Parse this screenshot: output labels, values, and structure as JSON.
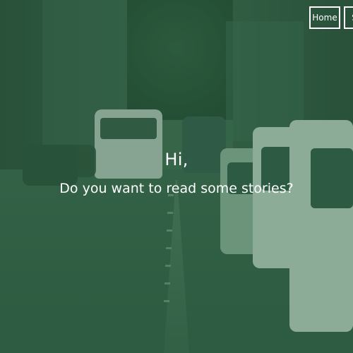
{
  "nav": {
    "home_label": "Home",
    "second_label": "S"
  },
  "hero": {
    "greeting": "Hi,",
    "subtitle": "Do you want to read some stories?"
  }
}
